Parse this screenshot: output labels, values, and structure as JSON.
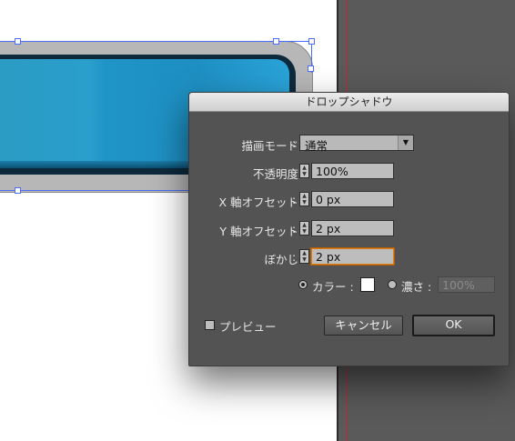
{
  "dialog": {
    "title": "ドロップシャドウ",
    "mode_label": "描画モード",
    "mode_value": "通常",
    "opacity_label": "不透明度",
    "opacity_value": "100%",
    "x_offset_label": "X 軸オフセット",
    "x_offset_value": "0 px",
    "y_offset_label": "Y 軸オフセット",
    "y_offset_value": "2 px",
    "blur_label": "ぼかし",
    "blur_value": "2 px",
    "color_label": "カラー :",
    "darkness_label": "濃さ :",
    "darkness_value": "100%",
    "preview_label": "プレビュー",
    "cancel_label": "キャンセル",
    "ok_label": "OK",
    "colon": ":",
    "shadow_color": "#ffffff"
  }
}
